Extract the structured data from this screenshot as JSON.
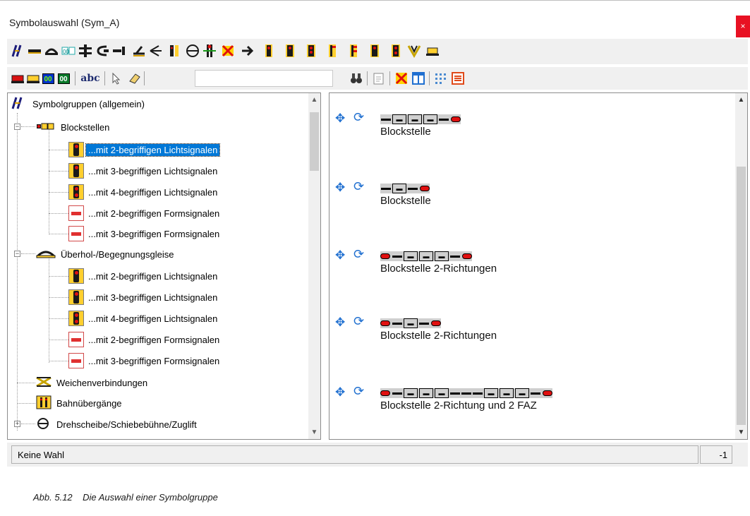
{
  "window": {
    "title": "Symbolauswahl (Sym_A)",
    "close_glyph": "×"
  },
  "toolbar1": {
    "icons": [
      "symbol-groups-icon",
      "track-straight-icon",
      "track-curve-icon",
      "counter-icon",
      "crossing-icon",
      "buffer-stop-icon",
      "track-end-icon",
      "turnout-left-icon",
      "turnout-right-icon",
      "signal-bar-icon",
      "turntable-icon",
      "level-crossing-icon",
      "delete-symbol-icon",
      "arrow-right-icon",
      "signal-red-1-icon",
      "signal-red-2-icon",
      "signal-red-3-icon",
      "signal-red-4-icon",
      "signal-red-5-icon",
      "signal-red-6-icon",
      "signal-red-7-icon",
      "yellow-v-icon",
      "loco-icon"
    ]
  },
  "toolbar2": {
    "search_value": "",
    "abc_label": "abc",
    "num1": "00",
    "num2": "00"
  },
  "tree": {
    "root": "Symbolgruppen (allgemein)",
    "groups": [
      {
        "label": "Blockstellen",
        "children": [
          "...mit 2-begriffigen Lichtsignalen",
          "...mit 3-begriffigen Lichtsignalen",
          "...mit 4-begriffigen Lichtsignalen",
          "...mit 2-begriffigen Formsignalen",
          "...mit 3-begriffigen Formsignalen"
        ]
      },
      {
        "label": "Überhol-/Begegnungsgleise",
        "children": [
          "...mit 2-begriffigen Lichtsignalen",
          "...mit 3-begriffigen Lichtsignalen",
          "...mit 4-begriffigen Lichtsignalen",
          "...mit 2-begriffigen Formsignalen",
          "...mit 3-begriffigen Formsignalen"
        ]
      }
    ],
    "others": [
      "Weichenverbindungen",
      "Bahnübergänge",
      "Drehscheibe/Schiebebühne/Zuglift"
    ],
    "selected": "...mit 2-begriffigen Lichtsignalen"
  },
  "symbols": [
    {
      "name": "Blockstelle"
    },
    {
      "name": "Blockstelle"
    },
    {
      "name": "Blockstelle 2-Richtungen"
    },
    {
      "name": "Blockstelle 2-Richtungen"
    },
    {
      "name": "Blockstelle 2-Richtung und 2 FAZ"
    }
  ],
  "status": {
    "text": "Keine Wahl",
    "value": "-1"
  },
  "caption": "Abb. 5.12    Die Auswahl einer Symbolgruppe",
  "colors": {
    "selection": "#0078d7",
    "signal_red": "#e01010",
    "signal_yellow": "#ffcf2e",
    "tool_blue": "#1f6fd0"
  }
}
